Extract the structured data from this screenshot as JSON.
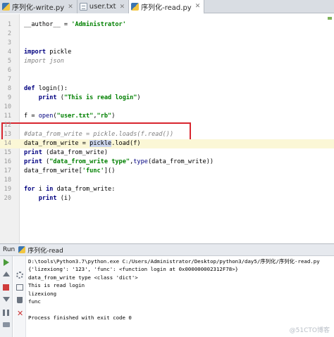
{
  "tabs": [
    {
      "label": "序列化-write.py",
      "icon": "python-file-icon",
      "active": false
    },
    {
      "label": "user.txt",
      "icon": "text-file-icon",
      "active": false
    },
    {
      "label": "序列化-read.py",
      "icon": "python-file-icon",
      "active": true
    }
  ],
  "editor": {
    "current_line": 14,
    "lines": [
      {
        "n": "1",
        "segs": [
          {
            "t": "__author__ = ",
            "c": ""
          },
          {
            "t": "'Administrator'",
            "c": "str"
          }
        ]
      },
      {
        "n": "2",
        "segs": []
      },
      {
        "n": "3",
        "segs": []
      },
      {
        "n": "4",
        "segs": [
          {
            "t": "import",
            "c": "kw"
          },
          {
            "t": " pickle",
            "c": ""
          }
        ]
      },
      {
        "n": "5",
        "segs": [
          {
            "t": "import json",
            "c": "cm"
          }
        ]
      },
      {
        "n": "6",
        "segs": []
      },
      {
        "n": "7",
        "segs": []
      },
      {
        "n": "8",
        "segs": [
          {
            "t": "def",
            "c": "kw"
          },
          {
            "t": " login():",
            "c": ""
          }
        ]
      },
      {
        "n": "9",
        "segs": [
          {
            "t": "    ",
            "c": ""
          },
          {
            "t": "print",
            "c": "kw"
          },
          {
            "t": " (",
            "c": ""
          },
          {
            "t": "\"This is read login\"",
            "c": "str"
          },
          {
            "t": ")",
            "c": ""
          }
        ]
      },
      {
        "n": "10",
        "segs": []
      },
      {
        "n": "11",
        "segs": [
          {
            "t": "f = ",
            "c": ""
          },
          {
            "t": "open",
            "c": "bi"
          },
          {
            "t": "(",
            "c": ""
          },
          {
            "t": "\"user.txt\"",
            "c": "str"
          },
          {
            "t": ",",
            "c": ""
          },
          {
            "t": "\"rb\"",
            "c": "str"
          },
          {
            "t": ")",
            "c": ""
          }
        ]
      },
      {
        "n": "12",
        "segs": []
      },
      {
        "n": "13",
        "segs": [
          {
            "t": "#data_from_write = pickle.loads(f.read())",
            "c": "cm"
          }
        ]
      },
      {
        "n": "14",
        "segs": [
          {
            "t": "data_from_write = ",
            "c": ""
          },
          {
            "t": "pickle",
            "c": "hl"
          },
          {
            "t": ".load(f)",
            "c": ""
          }
        ]
      },
      {
        "n": "15",
        "segs": [
          {
            "t": "print",
            "c": "kw"
          },
          {
            "t": " (data_from_write)",
            "c": ""
          }
        ]
      },
      {
        "n": "16",
        "segs": [
          {
            "t": "print",
            "c": "kw"
          },
          {
            "t": " (",
            "c": ""
          },
          {
            "t": "\"data_from_write type\"",
            "c": "str"
          },
          {
            "t": ",",
            "c": ""
          },
          {
            "t": "type",
            "c": "bi"
          },
          {
            "t": "(data_from_write))",
            "c": ""
          }
        ]
      },
      {
        "n": "17",
        "segs": [
          {
            "t": "data_from_write[",
            "c": ""
          },
          {
            "t": "'func'",
            "c": "str"
          },
          {
            "t": "]()",
            "c": ""
          }
        ]
      },
      {
        "n": "18",
        "segs": []
      },
      {
        "n": "19",
        "segs": [
          {
            "t": "for",
            "c": "kw"
          },
          {
            "t": " i ",
            "c": ""
          },
          {
            "t": "in",
            "c": "kw"
          },
          {
            "t": " data_from_write:",
            "c": ""
          }
        ]
      },
      {
        "n": "20",
        "segs": [
          {
            "t": "    ",
            "c": ""
          },
          {
            "t": "print",
            "c": "kw"
          },
          {
            "t": " (i)",
            "c": ""
          }
        ]
      }
    ]
  },
  "run": {
    "label": "Run",
    "config_name": "序列化-read",
    "output": [
      "D:\\tools\\Python3.7\\python.exe C:/Users/Administrator/Desktop/python3/day5/序列化/序列化-read.py",
      "{'lizexiong': '123', 'func': <function login at 0x000000002312F78>}",
      "data_from_write type <class 'dict'>",
      "This is read login",
      "lizexiong",
      "func",
      "",
      "Process finished with exit code 0"
    ]
  },
  "watermark": "@51CTO博客",
  "colors": {
    "keyword": "#000080",
    "string": "#008000",
    "comment": "#808080",
    "highlight_box": "#d8262f"
  }
}
